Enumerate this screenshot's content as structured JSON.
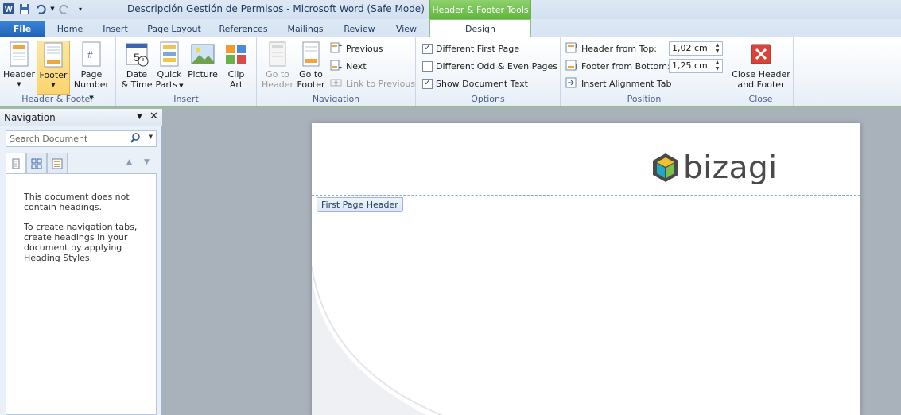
{
  "window": {
    "title": "Descripción Gestión de Permisos  -  Microsoft Word (Safe Mode)",
    "context_tool": "Header & Footer Tools"
  },
  "tabs": [
    "File",
    "Home",
    "Insert",
    "Page Layout",
    "References",
    "Mailings",
    "Review",
    "View",
    "Design"
  ],
  "ribbon": {
    "header_footer": {
      "header": "Header",
      "footer": "Footer",
      "page": "Page",
      "number": "Number",
      "label": "Header & Footer"
    },
    "insert": {
      "date": "Date",
      "time": "& Time",
      "quick": "Quick",
      "parts": "Parts",
      "picture": "Picture",
      "clip": "Clip",
      "art": "Art",
      "label": "Insert"
    },
    "navigation": {
      "goto": "Go to",
      "header": "Header",
      "goto2": "Go to",
      "footer": "Footer",
      "previous": "Previous",
      "next": "Next",
      "link": "Link to Previous",
      "label": "Navigation"
    },
    "options": {
      "diff_first": "Different First Page",
      "diff_odd_even": "Different Odd & Even Pages",
      "show_doc_text": "Show Document Text",
      "label": "Options"
    },
    "position": {
      "header_from_top": "Header from Top:",
      "header_value": "1,02 cm",
      "footer_from_bottom": "Footer from Bottom:",
      "footer_value": "1,25 cm",
      "insert_tab": "Insert Alignment Tab",
      "label": "Position"
    },
    "close": {
      "line1": "Close Header",
      "line2": "and Footer",
      "label": "Close"
    }
  },
  "nav_pane": {
    "title": "Navigation",
    "search_placeholder": "Search Document",
    "message1": "This document does not contain headings.",
    "message2": "To create navigation tabs, create headings in your document by applying Heading Styles."
  },
  "document": {
    "header_label": "First Page Header",
    "logo_text": "bizagi"
  },
  "colors": {
    "accent_green": "#5fb53c",
    "file_blue": "#1f63b8",
    "logo_teal": "#1fa9c5",
    "logo_green": "#7cc24a",
    "logo_yellow": "#f2c12e",
    "logo_dark": "#4a4a4a"
  }
}
